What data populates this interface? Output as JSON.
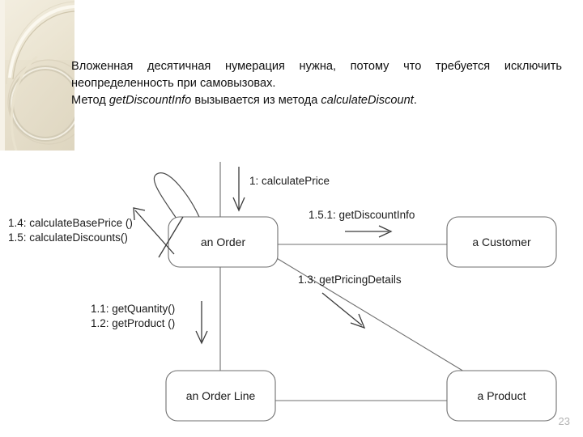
{
  "slide": {
    "page_number": "23",
    "text": {
      "paragraph1": "Вложенная десятичная нумерация нужна, потому что требуется исключить неопределенность при самовызовах.",
      "paragraph2_prefix": "Метод ",
      "paragraph2_italic1": "getDiscountInfo",
      "paragraph2_middle": " вызывается из метода ",
      "paragraph2_italic2": "calculateDiscount",
      "paragraph2_suffix": "."
    }
  },
  "diagram": {
    "type": "uml-communication-diagram",
    "objects": [
      {
        "id": "order",
        "label": "an Order"
      },
      {
        "id": "customer",
        "label": "a Customer"
      },
      {
        "id": "order_line",
        "label": "an Order Line"
      },
      {
        "id": "product",
        "label": "a Product"
      }
    ],
    "messages": [
      {
        "id": "m1",
        "label": "1: calculatePrice",
        "from": "external",
        "to": "order"
      },
      {
        "id": "m14",
        "label": "1.4: calculateBasePrice ()",
        "from": "order",
        "to": "order"
      },
      {
        "id": "m15",
        "label": "1.5: calculateDiscounts()",
        "from": "order",
        "to": "order"
      },
      {
        "id": "m151",
        "label": "1.5.1: getDiscountInfo",
        "from": "order",
        "to": "customer"
      },
      {
        "id": "m13",
        "label": "1.3: getPricingDetails",
        "from": "order",
        "to": "product"
      },
      {
        "id": "m11",
        "label": "1.1: getQuantity()",
        "from": "order",
        "to": "order_line"
      },
      {
        "id": "m12",
        "label": "1.2: getProduct ()",
        "from": "order",
        "to": "order_line"
      }
    ],
    "colors": {
      "box_stroke": "#6f6f6f",
      "line_stroke": "#6f6f6f",
      "arrow_stroke": "#3a3a3a",
      "text": "#1a1a1a",
      "page_number": "#b3b3b3",
      "deco_base": "#efe9d8",
      "deco_accent": "#d9d2bd"
    }
  }
}
